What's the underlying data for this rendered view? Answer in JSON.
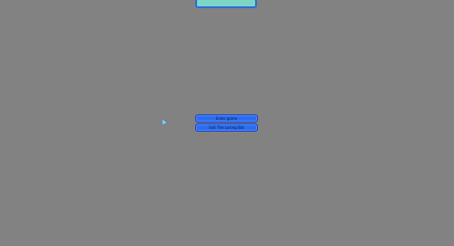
{
  "menu": {
    "buttons": [
      {
        "label": "Enter game"
      },
      {
        "label": "Exit The Losing Bot"
      }
    ]
  },
  "colors": {
    "background": "#828282",
    "button_fill": "#2b6df0",
    "button_border": "#1a3fbf",
    "top_bar_fill": "#7cd6c6",
    "cursor": "#7fdcff"
  },
  "icons": {
    "pointer": "arrow-cursor-icon"
  }
}
